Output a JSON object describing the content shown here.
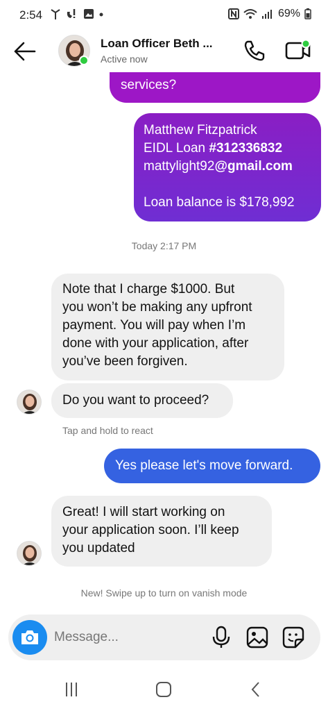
{
  "status_bar": {
    "time": "2:54",
    "battery": "69%"
  },
  "header": {
    "contact_name": "Loan Officer Beth ...",
    "contact_status": "Active now"
  },
  "messages": [
    {
      "direction": "outgoing",
      "lines": [
        "services?"
      ]
    },
    {
      "direction": "outgoing",
      "lines_parts": [
        [
          {
            "t": "Matthew Fitzpatrick"
          }
        ],
        [
          {
            "t": "EIDL Loan "
          },
          {
            "t": "#312336832",
            "b": true
          }
        ],
        [
          {
            "t": "mattylight92"
          },
          {
            "t": "@gmail.com",
            "b": true
          }
        ],
        [],
        [
          {
            "t": "Loan balance is $178,992"
          }
        ]
      ]
    },
    {
      "direction": "incoming",
      "lines": [
        "Note that I charge $1000. But",
        "you won’t be making any upfront",
        "payment. You will pay when I’m",
        "done with your application, after",
        "you’ve been forgiven."
      ]
    },
    {
      "direction": "incoming",
      "lines": [
        "Do you want to proceed?"
      ]
    },
    {
      "direction": "outgoing",
      "lines": [
        "Yes please let's move forward."
      ]
    },
    {
      "direction": "incoming",
      "lines": [
        "Great! I will start working on",
        "your application soon. I’ll keep",
        "you updated"
      ]
    }
  ],
  "timestamp": "Today 2:17 PM",
  "react_hint": "Tap and hold to react",
  "vanish_hint": "New! Swipe up to turn on vanish mode",
  "composer": {
    "placeholder": "Message..."
  },
  "colors": {
    "outgoing_purple": "#9d17c6",
    "outgoing_blue": "#3562e1",
    "incoming_gray": "#efefef",
    "online_green": "#2ecc40",
    "camera_blue": "#1a8cf0"
  }
}
